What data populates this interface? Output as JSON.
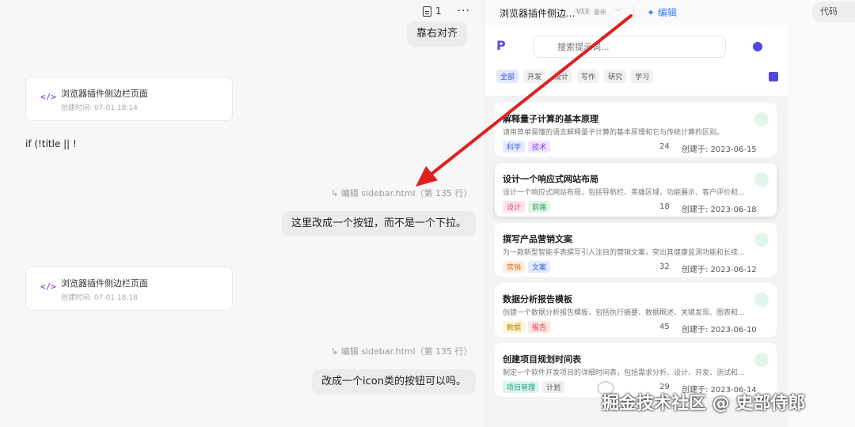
{
  "chat": {
    "toolbar": {
      "doc_count": "1",
      "more": "···"
    },
    "messages": {
      "align_right": "靠右对齐",
      "card1": {
        "title": "浏览器插件侧边栏页面",
        "subtitle": "创建时间: 07-01 18:14"
      },
      "code_line": "if (!title || !",
      "edit_ref1": "↳ 编辑 sidebar.html（第 135 行）",
      "msg1": "这里改成一个按钮，而不是一个下拉。",
      "card2": {
        "title": "浏览器插件侧边栏页面",
        "subtitle": "创建时间: 07-01 18:18"
      },
      "edit_ref2": "↳ 编辑 sidebar.html（第 135 行）",
      "msg2": "改成一个icon类的按钮可以吗。"
    }
  },
  "panel": {
    "title": "浏览器插件侧边...",
    "version": "V13",
    "latest": "最新",
    "edit_label": "编辑",
    "code_label": "代码"
  },
  "app": {
    "logo": "P",
    "search_placeholder": "搜索提示词...",
    "filters": [
      "全部",
      "开发",
      "设计",
      "写作",
      "研究",
      "学习"
    ],
    "cards": [
      {
        "title": "解释量子计算的基本原理",
        "desc": "请用简单易懂的语言解释量子计算的基本原理和它与传统计算的区别。",
        "tags": [
          {
            "label": "科学",
            "bg": "#e4ecff",
            "fg": "#3b5bd6"
          },
          {
            "label": "技术",
            "bg": "#efe4ff",
            "fg": "#7b3fd6"
          }
        ],
        "count": "24",
        "date": "创建于: 2023-06-15"
      },
      {
        "title": "设计一个响应式网站布局",
        "desc": "设计一个响应式网站布局，包括导航栏、英雄区域、功能展示、客户评价和...",
        "tags": [
          {
            "label": "设计",
            "bg": "#fde4ee",
            "fg": "#d63f7b"
          },
          {
            "label": "前端",
            "bg": "#e1f5e6",
            "fg": "#2f9a52"
          }
        ],
        "count": "18",
        "date": "创建于: 2023-06-18"
      },
      {
        "title": "撰写产品营销文案",
        "desc": "为一款新型智能手表撰写引人注目的营销文案，突出其健康监测功能和长续...",
        "tags": [
          {
            "label": "营销",
            "bg": "#ffeede",
            "fg": "#d6702f"
          },
          {
            "label": "文案",
            "bg": "#e4ecff",
            "fg": "#3b5bd6"
          }
        ],
        "count": "32",
        "date": "创建于: 2023-06-12"
      },
      {
        "title": "数据分析报告模板",
        "desc": "创建一个数据分析报告模板，包括执行摘要、数据概述、关键发现、图表和...",
        "tags": [
          {
            "label": "数据",
            "bg": "#fff4d6",
            "fg": "#b38600"
          },
          {
            "label": "报告",
            "bg": "#fde4e4",
            "fg": "#d63f3f"
          }
        ],
        "count": "45",
        "date": "创建于: 2023-06-10"
      },
      {
        "title": "创建项目规划时间表",
        "desc": "制定一个软件开发项目的详细时间表，包括需求分析、设计、开发、测试和...",
        "tags": [
          {
            "label": "项目管理",
            "bg": "#ddf5ef",
            "fg": "#1f9a7a"
          },
          {
            "label": "计划",
            "bg": "#f0f0f0",
            "fg": "#555555"
          }
        ],
        "count": "29",
        "date": "创建于: 2023-06-14"
      }
    ]
  },
  "watermark": "掘金技术社区 @ 史部侍郎",
  "colors": {
    "accent": "#5046e5",
    "arrow": "#e02020",
    "edit_blue": "#3b82f6"
  }
}
